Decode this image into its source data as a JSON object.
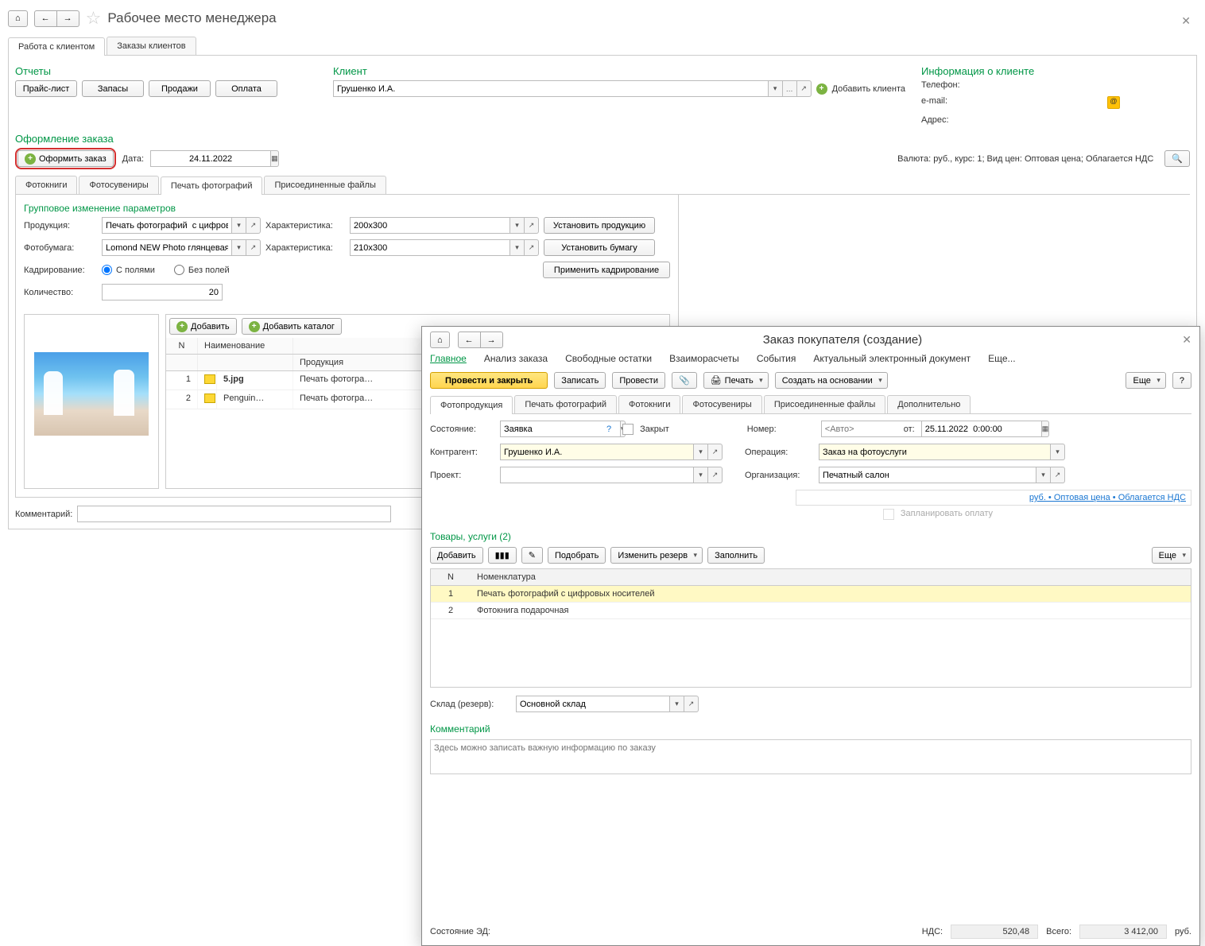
{
  "title": "Рабочее место менеджера",
  "main_tabs": [
    "Работа с клиентом",
    "Заказы клиентов"
  ],
  "reports": {
    "header": "Отчеты",
    "buttons": [
      "Прайс-лист",
      "Запасы",
      "Продажи",
      "Оплата"
    ]
  },
  "client": {
    "header": "Клиент",
    "value": "Грушенко И.А.",
    "add_btn": "Добавить клиента"
  },
  "client_info": {
    "header": "Информация о клиенте",
    "phone_label": "Телефон:",
    "email_label": "e-mail:",
    "address_label": "Адрес:"
  },
  "order_form": {
    "header": "Оформление заказа",
    "create_btn": "Оформить заказ",
    "date_label": "Дата:",
    "date_value": "24.11.2022",
    "currency_text": "Валюта: руб., курс: 1; Вид цен: Оптовая цена; Облагается НДС"
  },
  "doc_tabs": [
    "Фотокниги",
    "Фотосувениры",
    "Печать фотографий",
    "Присоединенные файлы"
  ],
  "group_change": {
    "header": "Групповое изменение параметров",
    "product_label": "Продукция:",
    "product_value": "Печать фотографий  с цифровых носи",
    "char_label": "Характеристика:",
    "char_value1": "200х300",
    "paper_label": "Фотобумага:",
    "paper_value": "Lomond NEW Photo глянцевая",
    "char_value2": "210x300",
    "crop_label": "Кадрирование:",
    "crop_opt1": "С полями",
    "crop_opt2": "Без полей",
    "qty_label": "Количество:",
    "qty_value": "20",
    "set_product_btn": "Установить продукцию",
    "set_paper_btn": "Установить бумагу",
    "apply_crop_btn": "Применить кадрирование",
    "add_btn": "Добавить",
    "add_cat_btn": "Добавить каталог"
  },
  "columns": {
    "n": "N",
    "name": "Наименование",
    "prod": "Продукция"
  },
  "files": [
    {
      "n": "1",
      "name": "5.jpg",
      "prod": "Печать фотогра…"
    },
    {
      "n": "2",
      "name": "Penguin…",
      "prod": "Печать фотогра…"
    }
  ],
  "comment_label": "Комментарий:",
  "modal": {
    "title": "Заказ покупателя (создание)",
    "nav": [
      "Главное",
      "Анализ заказа",
      "Свободные остатки",
      "Взаиморасчеты",
      "События",
      "Актуальный электронный документ",
      "Еще..."
    ],
    "post_close": "Провести и закрыть",
    "save": "Записать",
    "post": "Провести",
    "print": "Печать",
    "create_based": "Создать на основании",
    "more": "Еще",
    "sub_tabs": [
      "Фотопродукция",
      "Печать фотографий",
      "Фотокниги",
      "Фотосувениры",
      "Присоединенные файлы",
      "Дополнительно"
    ],
    "state_label": "Состояние:",
    "state_value": "Заявка",
    "closed_label": "Закрыт",
    "number_label": "Номер:",
    "number_placeholder": "<Авто>",
    "from_label": "от:",
    "date_value": "25.11.2022  0:00:00",
    "partner_label": "Контрагент:",
    "partner_value": "Грушенко И.А.",
    "operation_label": "Операция:",
    "operation_value": "Заказ на фотоуслуги",
    "project_label": "Проект:",
    "org_label": "Организация:",
    "org_value": "Печатный салон",
    "price_link": "руб. • Оптовая цена • Облагается НДС",
    "plan_pay": "Запланировать оплату",
    "goods_header": "Товары, услуги (2)",
    "g_add": "Добавить",
    "g_pick": "Подобрать",
    "g_reserve": "Изменить резерв",
    "g_fill": "Заполнить",
    "g_more": "Еще",
    "g_cols": {
      "n": "N",
      "nom": "Номенклатура"
    },
    "g_rows": [
      {
        "n": "1",
        "nom": "Печать фотографий  с цифровых носителей"
      },
      {
        "n": "2",
        "nom": "Фотокнига подарочная"
      }
    ],
    "stock_label": "Склад (резерв):",
    "stock_value": "Основной склад",
    "comment_header": "Комментарий",
    "comment_placeholder": "Здесь можно записать важную информацию по заказу",
    "ed_state_label": "Состояние ЭД:",
    "nds_label": "НДС:",
    "nds_value": "520,48",
    "total_label": "Всего:",
    "total_value": "3 412,00",
    "currency": "руб."
  }
}
